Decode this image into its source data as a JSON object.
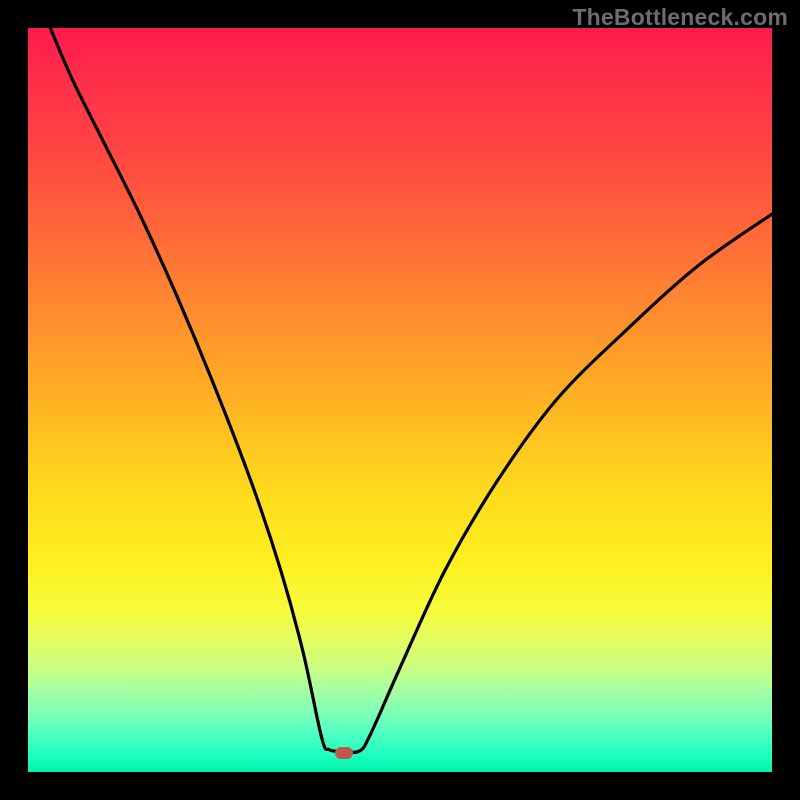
{
  "watermark": "TheBottleneck.com",
  "colors": {
    "frame": "#000000",
    "curve": "#000000",
    "marker": "#c1584f",
    "gradient_stops": [
      "#ff1a4d",
      "#ff2e4a",
      "#ff4742",
      "#ff6a38",
      "#ff8b2f",
      "#ffab26",
      "#ffc71f",
      "#ffde1d",
      "#fff021",
      "#f7fb3a",
      "#e7fd5e",
      "#c9fe82",
      "#a6ffa1",
      "#7effb7",
      "#4dffc3",
      "#1affc0",
      "#00f2ab"
    ]
  },
  "chart_data": {
    "type": "line",
    "title": "",
    "xlabel": "",
    "ylabel": "",
    "xlim": [
      0,
      1
    ],
    "ylim": [
      0,
      1
    ],
    "annotations": [
      {
        "type": "marker",
        "x": 0.425,
        "y": 0.025,
        "shape": "rounded-rect"
      }
    ],
    "series": [
      {
        "name": "curve",
        "x": [
          0.03,
          0.06,
          0.1,
          0.15,
          0.2,
          0.25,
          0.3,
          0.34,
          0.37,
          0.395,
          0.405,
          0.42,
          0.445,
          0.46,
          0.5,
          0.56,
          0.63,
          0.71,
          0.8,
          0.9,
          1.0
        ],
        "y": [
          1.0,
          0.93,
          0.85,
          0.75,
          0.64,
          0.52,
          0.39,
          0.27,
          0.16,
          0.045,
          0.03,
          0.028,
          0.028,
          0.05,
          0.14,
          0.27,
          0.39,
          0.5,
          0.59,
          0.68,
          0.75
        ]
      }
    ]
  }
}
